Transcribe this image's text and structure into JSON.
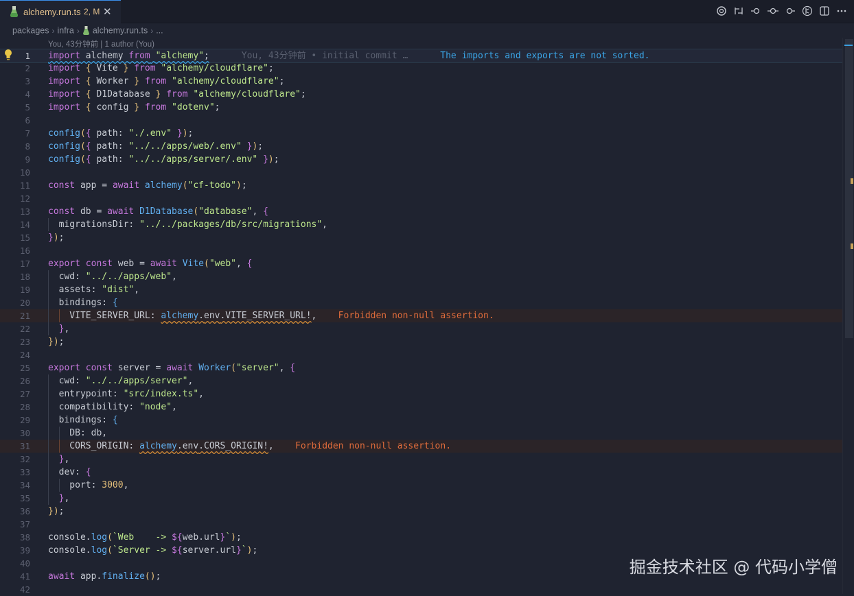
{
  "tab": {
    "filename": "alchemy.run.ts",
    "badge": "2, M",
    "close_glyph": "✕"
  },
  "breadcrumb": {
    "parts": [
      "packages",
      "infra",
      "alchemy.run.ts",
      "..."
    ]
  },
  "codelens": "You, 43分钟前 | 1 author (You)",
  "blame_hint": "You, 43分钟前 • initial commit …",
  "diagnostics": {
    "line1": "The imports and exports are not sorted.",
    "line21": "Forbidden non-null assertion.",
    "line31": "Forbidden non-null assertion."
  },
  "code_lines": [
    "import alchemy from \"alchemy\";",
    "import { Vite } from \"alchemy/cloudflare\";",
    "import { Worker } from \"alchemy/cloudflare\";",
    "import { D1Database } from \"alchemy/cloudflare\";",
    "import { config } from \"dotenv\";",
    "",
    "config({ path: \"./.env\" });",
    "config({ path: \"../../apps/web/.env\" });",
    "config({ path: \"../../apps/server/.env\" });",
    "",
    "const app = await alchemy(\"cf-todo\");",
    "",
    "const db = await D1Database(\"database\", {",
    "  migrationsDir: \"../../packages/db/src/migrations\",",
    "});",
    "",
    "export const web = await Vite(\"web\", {",
    "  cwd: \"../../apps/web\",",
    "  assets: \"dist\",",
    "  bindings: {",
    "    VITE_SERVER_URL: alchemy.env.VITE_SERVER_URL!,",
    "  },",
    "});",
    "",
    "export const server = await Worker(\"server\", {",
    "  cwd: \"../../apps/server\",",
    "  entrypoint: \"src/index.ts\",",
    "  compatibility: \"node\",",
    "  bindings: {",
    "    DB: db,",
    "    CORS_ORIGIN: alchemy.env.CORS_ORIGIN!,",
    "  },",
    "  dev: {",
    "    port: 3000,",
    "  },",
    "});",
    "",
    "console.log(`Web    -> ${web.url}`);",
    "console.log(`Server -> ${server.url}`);",
    "",
    "await app.finalize();",
    ""
  ],
  "line_numbers": [
    "1",
    "2",
    "3",
    "4",
    "5",
    "6",
    "7",
    "8",
    "9",
    "10",
    "11",
    "12",
    "13",
    "14",
    "15",
    "16",
    "17",
    "18",
    "19",
    "20",
    "21",
    "22",
    "23",
    "24",
    "25",
    "26",
    "27",
    "28",
    "29",
    "30",
    "31",
    "32",
    "33",
    "34",
    "35",
    "36",
    "37",
    "38",
    "39",
    "40",
    "41",
    "42"
  ],
  "watermark": "掘金技术社区 @ 代码小学僧",
  "colors": {
    "background": "#1f2330",
    "keyword": "#c678dd",
    "string": "#bde68c",
    "function": "#61afef",
    "info": "#3ba6e8",
    "warning": "#e06c3b"
  }
}
